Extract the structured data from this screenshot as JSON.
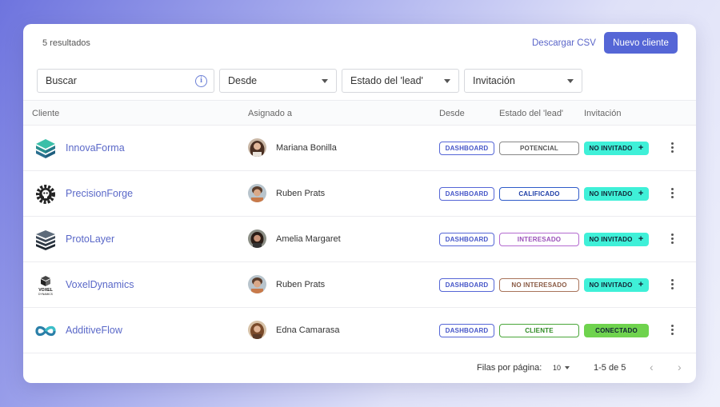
{
  "header": {
    "results": "5 resultados",
    "download_csv": "Descargar CSV",
    "new_client": "Nuevo cliente"
  },
  "filters": {
    "search_placeholder": "Buscar",
    "since": "Desde",
    "lead_state": "Estado del 'lead'",
    "invitation": "Invitación"
  },
  "columns": {
    "client": "Cliente",
    "assigned": "Asignado a",
    "since": "Desde",
    "lead_state": "Estado del 'lead'",
    "invitation": "Invitación"
  },
  "rows": [
    {
      "client": "InnovaForma",
      "logo": "stack-cube-logo",
      "assigned": "Mariana Bonilla",
      "since": "DASHBOARD",
      "lead": "POTENCIAL",
      "lead_color": "#888888",
      "invitation": "NO INVITADO",
      "inv_plus": "+",
      "inv_color": "#3ff0d8"
    },
    {
      "client": "PrecisionForge",
      "logo": "gear-skull-logo",
      "assigned": "Ruben Prats",
      "since": "DASHBOARD",
      "lead": "CALIFICADO",
      "lead_color": "#2f5bc9",
      "invitation": "NO INVITADO",
      "inv_plus": "+",
      "inv_color": "#3ff0d8"
    },
    {
      "client": "ProtoLayer",
      "logo": "layered-stack-logo",
      "assigned": "Amelia Margaret",
      "since": "DASHBOARD",
      "lead": "INTERESADO",
      "lead_color": "#b36bcf",
      "invitation": "NO INVITADO",
      "inv_plus": "+",
      "inv_color": "#3ff0d8"
    },
    {
      "client": "VoxelDynamics",
      "logo": "voxel-dynamics-logo",
      "assigned": "Ruben Prats",
      "since": "DASHBOARD",
      "lead": "NO INTERESADO",
      "lead_color": "#a8735a",
      "invitation": "NO INVITADO",
      "inv_plus": "+",
      "inv_color": "#3ff0d8"
    },
    {
      "client": "AdditiveFlow",
      "logo": "infinity-logo",
      "assigned": "Edna Camarasa",
      "since": "DASHBOARD",
      "lead": "CLIENTE",
      "lead_color": "#4aa63a",
      "invitation": "CONECTADO",
      "inv_plus": "",
      "inv_color": "#6fd34e"
    }
  ],
  "logo_text": {
    "voxel": "VOXEL",
    "dynamics": "DYNAMICS"
  },
  "footer": {
    "rows_per_page": "Filas por página:",
    "per_page_value": "10",
    "range": "1-5 de 5",
    "prev": "‹",
    "next": "›"
  }
}
